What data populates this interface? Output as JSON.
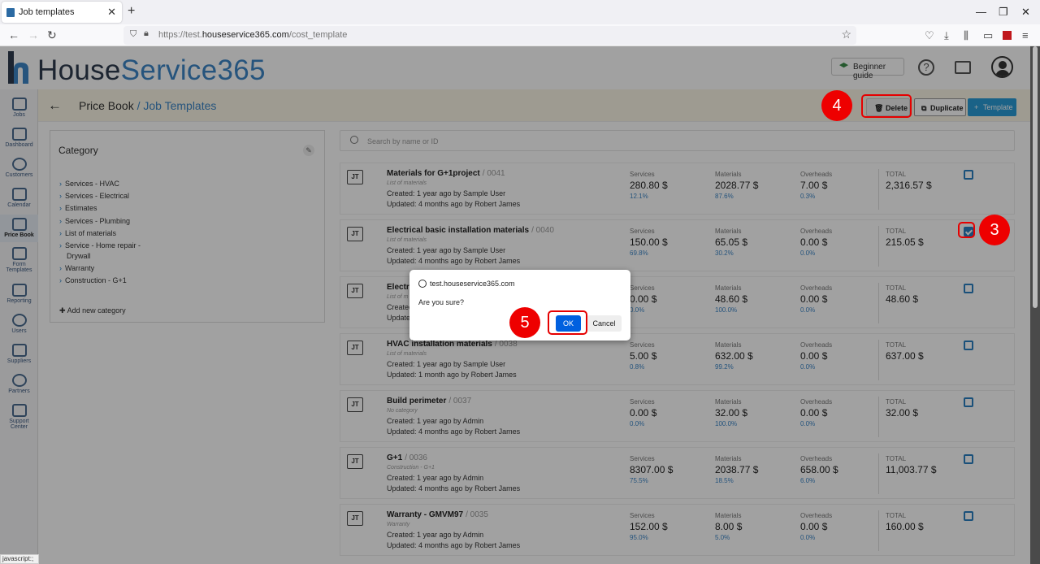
{
  "browser": {
    "tab_title": "Job templates",
    "tab_close": "✕",
    "new_tab": "+",
    "url_prefix": "https://test.",
    "url_host": "houseservice365.com",
    "url_path": "/cost_template",
    "status": "javascript:;"
  },
  "logo": {
    "part1": "House",
    "part2": "Service365"
  },
  "topbar": {
    "guide_label": "Beginner guide",
    "help_symbol": "?"
  },
  "sidebar": {
    "items": [
      {
        "label": "Jobs"
      },
      {
        "label": "Dashboard"
      },
      {
        "label": "Customers"
      },
      {
        "label": "Calendar"
      },
      {
        "label": "Price Book"
      },
      {
        "label": "Form Templates"
      },
      {
        "label": "Reporting"
      },
      {
        "label": "Users"
      },
      {
        "label": "Suppliers"
      },
      {
        "label": "Partners"
      },
      {
        "label": "Support Center"
      }
    ]
  },
  "header": {
    "crumb_root": "Price Book",
    "crumb_sep": " / ",
    "crumb_current": "Job Templates",
    "delete_label": "Delete",
    "duplicate_label": "Duplicate",
    "template_label": "Template"
  },
  "category": {
    "title": "Category",
    "items": [
      "Services - HVAC",
      "Services - Electrical",
      "Estimates",
      "Services - Plumbing",
      "List of materials",
      "Service - Home repair -",
      "Warranty",
      "Construction - G+1"
    ],
    "item6_cont": "Drywall",
    "add_label": "Add new category"
  },
  "search": {
    "placeholder": "Search by name or ID"
  },
  "columns": {
    "services": "Services",
    "materials": "Materials",
    "overheads": "Overheads",
    "total": "TOTAL"
  },
  "rows": [
    {
      "badge": "JT",
      "name": "Materials for G+1project",
      "id": "/ 0041",
      "category": "List of materials",
      "created": "Created: 1 year ago by Sample User",
      "updated": "Updated: 4 months ago by Robert James",
      "services": "280.80 $",
      "services_pct": "12.1%",
      "materials": "2028.77 $",
      "materials_pct": "87.6%",
      "overheads": "7.00 $",
      "overheads_pct": "0.3%",
      "total": "2,316.57 $",
      "checked": false
    },
    {
      "badge": "JT",
      "name": "Electrical basic installation materials",
      "id": "/ 0040",
      "category": "List of materials",
      "created": "Created: 1 year ago by Sample User",
      "updated": "Updated: 4 months ago by Robert James",
      "services": "150.00 $",
      "services_pct": "69.8%",
      "materials": "65.05 $",
      "materials_pct": "30.2%",
      "overheads": "0.00 $",
      "overheads_pct": "0.0%",
      "total": "215.05 $",
      "checked": true
    },
    {
      "badge": "JT",
      "name": "Electric",
      "id": "",
      "category": "List of m",
      "created": "Created",
      "updated": "Updated",
      "services": "0.00 $",
      "services_pct": "0.0%",
      "materials": "48.60 $",
      "materials_pct": "100.0%",
      "overheads": "0.00 $",
      "overheads_pct": "0.0%",
      "total": "48.60 $",
      "checked": false
    },
    {
      "badge": "JT",
      "name": "HVAC installation materials",
      "id": "/ 0038",
      "category": "List of materials",
      "created": "Created: 1 year ago by Sample User",
      "updated": "Updated: 1 month ago by Robert James",
      "services": "5.00 $",
      "services_pct": "0.8%",
      "materials": "632.00 $",
      "materials_pct": "99.2%",
      "overheads": "0.00 $",
      "overheads_pct": "0.0%",
      "total": "637.00 $",
      "checked": false
    },
    {
      "badge": "JT",
      "name": "Build perimeter",
      "id": "/ 0037",
      "category": "No category",
      "created": "Created: 1 year ago by Admin",
      "updated": "Updated: 4 months ago by Robert James",
      "services": "0.00 $",
      "services_pct": "0.0%",
      "materials": "32.00 $",
      "materials_pct": "100.0%",
      "overheads": "0.00 $",
      "overheads_pct": "0.0%",
      "total": "32.00 $",
      "checked": false
    },
    {
      "badge": "JT",
      "name": "G+1",
      "id": "/ 0036",
      "category": "Construction - G+1",
      "created": "Created: 1 year ago by Admin",
      "updated": "Updated: 4 months ago by Robert James",
      "services": "8307.00 $",
      "services_pct": "75.5%",
      "materials": "2038.77 $",
      "materials_pct": "18.5%",
      "overheads": "658.00 $",
      "overheads_pct": "6.0%",
      "total": "11,003.77 $",
      "checked": false
    },
    {
      "badge": "JT",
      "name": "Warranty - GMVM97",
      "id": "/ 0035",
      "category": "Warranty",
      "created": "Created: 1 year ago by Admin",
      "updated": "Updated: 4 months ago by Robert James",
      "services": "152.00 $",
      "services_pct": "95.0%",
      "materials": "8.00 $",
      "materials_pct": "5.0%",
      "overheads": "0.00 $",
      "overheads_pct": "0.0%",
      "total": "160.00 $",
      "checked": false
    }
  ],
  "dialog": {
    "host": "test.houseservice365.com",
    "message": "Are you sure?",
    "ok_label": "OK",
    "cancel_label": "Cancel"
  },
  "annotations": {
    "step3": "3",
    "step4": "4",
    "step5": "5"
  },
  "colors": {
    "accent": "#2a9bd6",
    "annotation": "#e60000",
    "ok_button": "#0060df"
  }
}
